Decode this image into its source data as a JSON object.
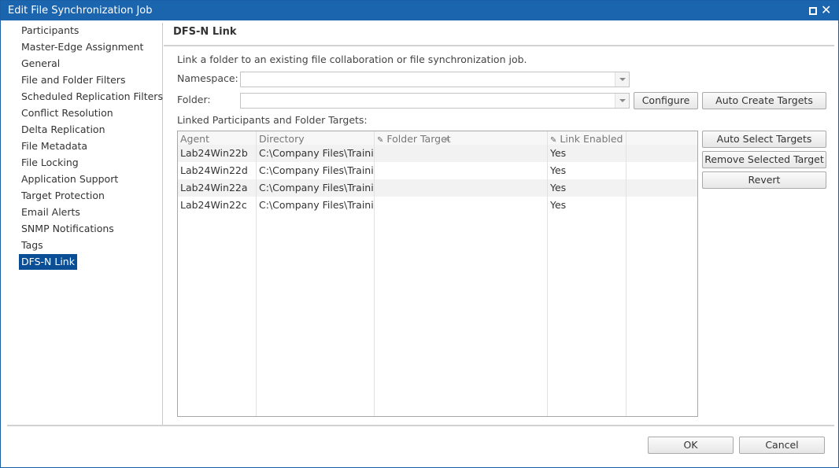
{
  "window": {
    "title": "Edit File Synchronization Job"
  },
  "sidebar": {
    "items": [
      {
        "label": "Participants"
      },
      {
        "label": "Master-Edge Assignment"
      },
      {
        "label": "General"
      },
      {
        "label": "File and Folder Filters"
      },
      {
        "label": "Scheduled Replication Filters"
      },
      {
        "label": "Conflict Resolution"
      },
      {
        "label": "Delta Replication"
      },
      {
        "label": "File Metadata"
      },
      {
        "label": "File Locking"
      },
      {
        "label": "Application Support"
      },
      {
        "label": "Target Protection"
      },
      {
        "label": "Email Alerts"
      },
      {
        "label": "SNMP Notifications"
      },
      {
        "label": "Tags"
      },
      {
        "label": "DFS-N Link"
      }
    ],
    "selected": "DFS-N Link"
  },
  "main": {
    "title": "DFS-N Link",
    "description": "Link a folder to an existing file collaboration or file synchronization job.",
    "namespace": {
      "label": "Namespace:",
      "value": ""
    },
    "folder": {
      "label": "Folder:",
      "value": ""
    },
    "configure_button": "Configure",
    "auto_create_button": "Auto Create Targets",
    "linked_label": "Linked Participants and Folder Targets:",
    "table": {
      "columns": [
        "Agent",
        "Directory",
        "Folder Target",
        "Link Enabled"
      ],
      "sorted_column": "Directory",
      "rows": [
        {
          "agent": "Lab24Win22b",
          "directory": "C:\\Company Files\\Traini",
          "folder_target": "",
          "link_enabled": "Yes"
        },
        {
          "agent": "Lab24Win22d",
          "directory": "C:\\Company Files\\Traini",
          "folder_target": "",
          "link_enabled": "Yes"
        },
        {
          "agent": "Lab24Win22a",
          "directory": "C:\\Company Files\\Traini",
          "folder_target": "",
          "link_enabled": "Yes"
        },
        {
          "agent": "Lab24Win22c",
          "directory": "C:\\Company Files\\Traini",
          "folder_target": "",
          "link_enabled": "Yes"
        }
      ]
    },
    "side_buttons": {
      "auto_select": "Auto Select Targets",
      "remove_selected": "Remove Selected Target",
      "revert": "Revert"
    }
  },
  "footer": {
    "ok": "OK",
    "cancel": "Cancel"
  },
  "colors": {
    "titlebar": "#1b64ae",
    "selection": "#0a4f96"
  },
  "icons": [
    "maximize-icon",
    "close-icon",
    "pencil-icon",
    "dropdown-arrow-icon",
    "sort-ascending-icon"
  ]
}
